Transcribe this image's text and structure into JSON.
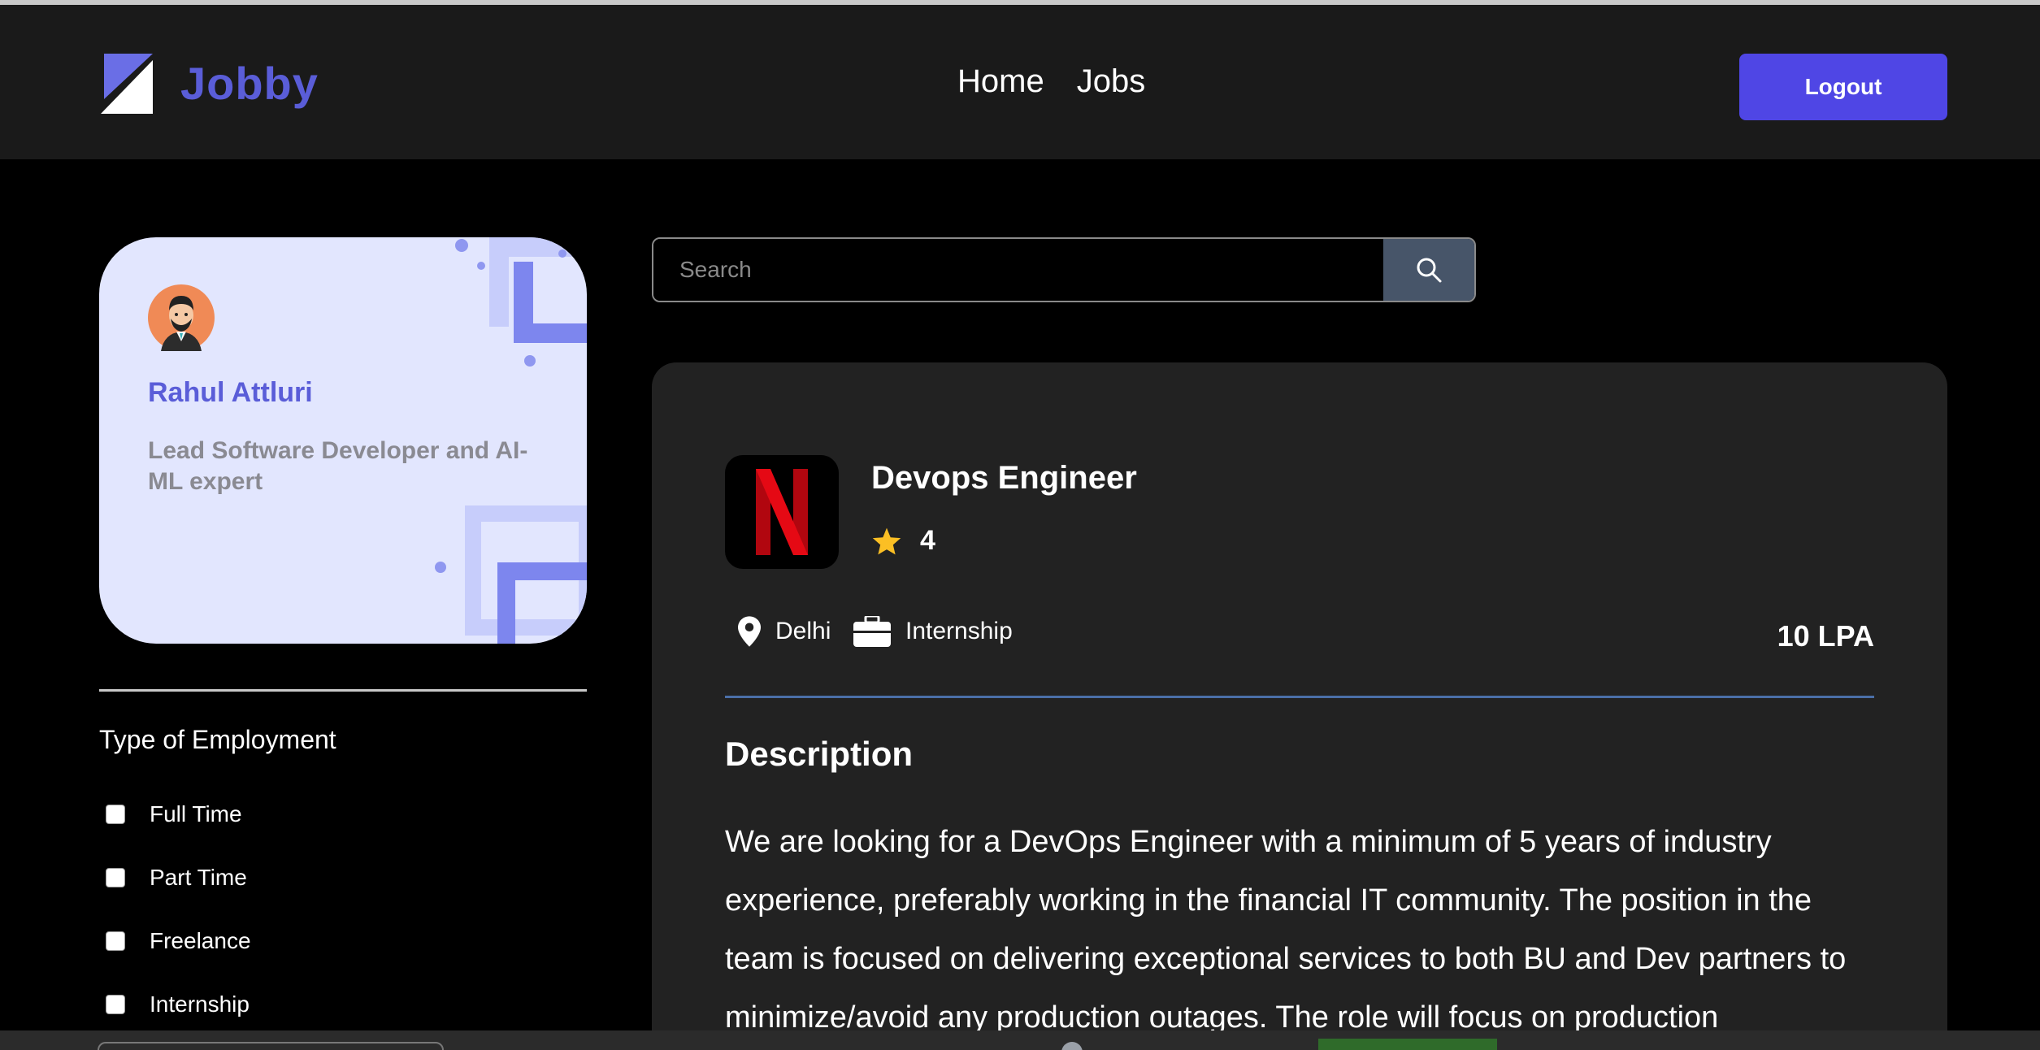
{
  "header": {
    "logo_text": "Jobby",
    "nav": [
      "Home",
      "Jobs"
    ],
    "logout_label": "Logout"
  },
  "profile": {
    "name": "Rahul Attluri",
    "bio": "Lead Software Developer and AI-ML expert"
  },
  "filters": {
    "employment_title": "Type of Employment",
    "employment_options": [
      "Full Time",
      "Part Time",
      "Freelance",
      "Internship"
    ]
  },
  "search": {
    "placeholder": "Search"
  },
  "job": {
    "title": "Devops Engineer",
    "rating": "4",
    "location": "Delhi",
    "employment_type": "Internship",
    "package": "10 LPA",
    "description_heading": "Description",
    "description": "We are looking for a DevOps Engineer with a minimum of 5 years of industry experience, preferably working in the financial IT community. The position in the team is focused on delivering exceptional services to both BU and Dev partners to minimize/avoid any production outages. The role will focus on production"
  },
  "colors": {
    "accent": "#4f46e5",
    "brand_text": "#5a5dd8",
    "header_bg": "#1a1a1a",
    "card_bg": "#222222",
    "profile_bg": "#e2e6fe",
    "star": "#fbbf24",
    "netflix_red": "#e50914"
  },
  "icons": {
    "logo": "jobby-logo-icon",
    "search": "search-icon",
    "star": "star-icon",
    "location": "location-pin-icon",
    "briefcase": "briefcase-icon"
  }
}
